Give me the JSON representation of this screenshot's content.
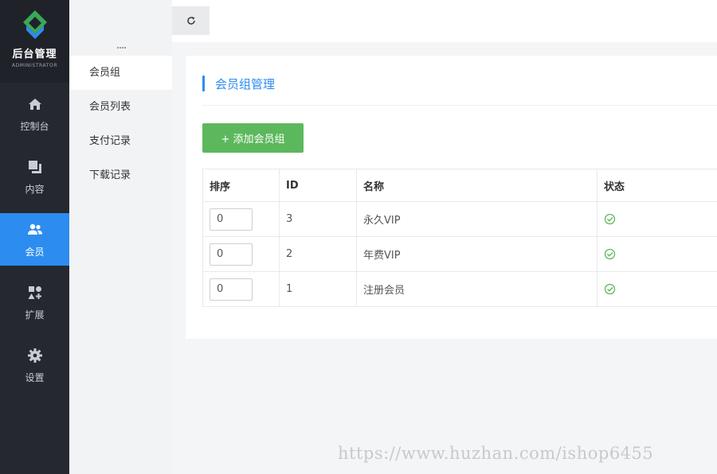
{
  "logo": {
    "title": "后台管理",
    "subtitle": "ADMINISTRATOR"
  },
  "nav": [
    {
      "label": "控制台",
      "icon": "home-icon"
    },
    {
      "label": "内容",
      "icon": "copy-icon"
    },
    {
      "label": "会员",
      "icon": "users-icon",
      "active": true
    },
    {
      "label": "扩展",
      "icon": "apps-icon"
    },
    {
      "label": "设置",
      "icon": "gear-icon"
    }
  ],
  "subnav": [
    {
      "label": "会员组",
      "active": true
    },
    {
      "label": "会员列表"
    },
    {
      "label": "支付记录"
    },
    {
      "label": "下载记录"
    }
  ],
  "toolbar": {
    "refresh_icon": "refresh-icon"
  },
  "panel": {
    "title": "会员组管理",
    "add_button": "+ 添加会员组"
  },
  "table": {
    "headers": [
      "排序",
      "ID",
      "名称",
      "状态"
    ],
    "rows": [
      {
        "sort": "0",
        "id": "3",
        "name": "永久VIP",
        "status": "enabled"
      },
      {
        "sort": "0",
        "id": "2",
        "name": "年费VIP",
        "status": "enabled"
      },
      {
        "sort": "0",
        "id": "1",
        "name": "注册会员",
        "status": "enabled"
      }
    ]
  },
  "watermark": "https://www.huzhan.com/ishop6455",
  "colors": {
    "accent": "#2d8cf0",
    "success": "#5cb85c",
    "nav_bg": "#25292f"
  }
}
